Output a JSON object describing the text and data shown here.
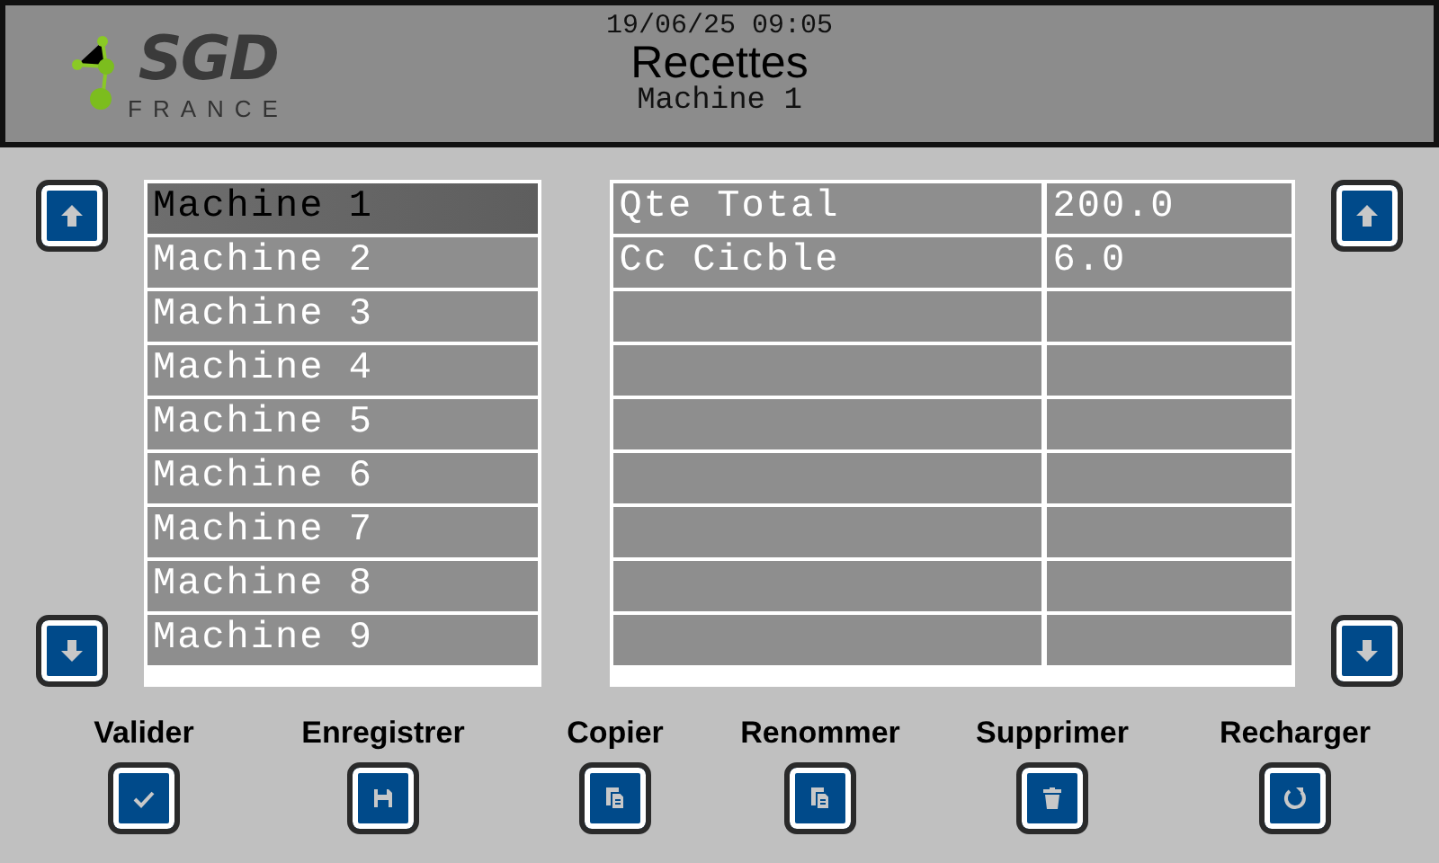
{
  "header": {
    "logo": {
      "name": "SGD",
      "tagline": "FRANCE"
    },
    "datetime": "19/06/25 09:05",
    "title": "Recettes",
    "subtitle": "Machine 1"
  },
  "recipes": [
    {
      "label": "Machine 1",
      "selected": true
    },
    {
      "label": "Machine 2",
      "selected": false
    },
    {
      "label": "Machine 3",
      "selected": false
    },
    {
      "label": "Machine 4",
      "selected": false
    },
    {
      "label": "Machine 5",
      "selected": false
    },
    {
      "label": "Machine 6",
      "selected": false
    },
    {
      "label": "Machine 7",
      "selected": false
    },
    {
      "label": "Machine 8",
      "selected": false
    },
    {
      "label": "Machine 9",
      "selected": false
    }
  ],
  "parameters": [
    {
      "name": "Qte Total",
      "value": "200.0"
    },
    {
      "name": "Cc Cicble",
      "value": "6.0"
    }
  ],
  "actions": [
    {
      "label": "Valider",
      "kind": "check"
    },
    {
      "label": "Enregistrer",
      "kind": "save"
    },
    {
      "label": "Copier",
      "kind": "copy"
    },
    {
      "label": "Renommer",
      "kind": "copy"
    },
    {
      "label": "Supprimer",
      "kind": "delete"
    },
    {
      "label": "Recharger",
      "kind": "reload"
    }
  ]
}
